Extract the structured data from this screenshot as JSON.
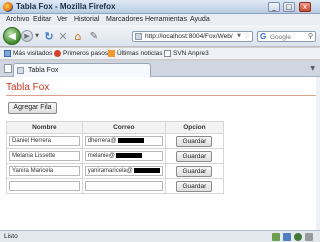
{
  "window": {
    "title": "Tabla Fox - Mozilla Firefox",
    "controls": [
      "_",
      "□",
      "x"
    ]
  },
  "menu": [
    "Archivo",
    "Editar",
    "Ver",
    "Historial",
    "Marcadores",
    "Herramientas",
    "Ayuda"
  ],
  "nav": {
    "url": "http://localhost:8004/Fox/Web/",
    "search_placeholder": "Google",
    "search_engine_letter": "G"
  },
  "bookmarks": [
    "Más visitados",
    "Primeros pasos",
    "Últimas noticias",
    "SVN Anpre3"
  ],
  "tab": {
    "label": "Tabla Fox"
  },
  "page": {
    "title": "Tabla Fox",
    "add_button": "Agregar Fila",
    "table": {
      "headers": [
        "Nombre",
        "Correo",
        "Opcion"
      ],
      "rows": [
        {
          "nombre": "Daniel Herrera",
          "correo": "dherrera@",
          "button": "Guardar"
        },
        {
          "nombre": "Melania Lissette",
          "correo": "melanie@",
          "button": "Guardar"
        },
        {
          "nombre": "Yanira Maricela",
          "correo": "yaniramaricela@",
          "button": "Guardar"
        },
        {
          "nombre": "",
          "correo": "",
          "button": "Guardar"
        }
      ]
    }
  },
  "status": {
    "text": "Listo"
  },
  "colors": {
    "page_title": "#c43a1e",
    "accent": "#3f8c2d"
  }
}
